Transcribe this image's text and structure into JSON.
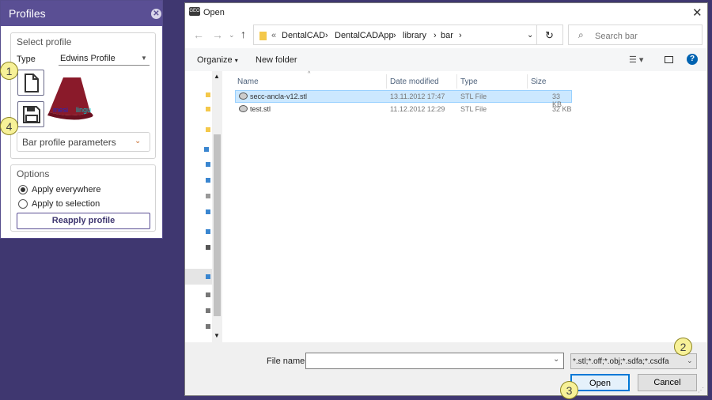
{
  "profiles": {
    "title": "Profiles",
    "select_profile_label": "Select profile",
    "type_label": "Type",
    "type_value": "Edwins Profile",
    "preview_labels": {
      "left": "mesi",
      "right": "lingu"
    },
    "bar_params_label": "Bar profile parameters",
    "options_label": "Options",
    "apply_everywhere": "Apply everywhere",
    "apply_selection": "Apply to selection",
    "reapply_button": "Reapply profile"
  },
  "dialog": {
    "title": "Open",
    "app_icon_text": "GEO",
    "breadcrumb": [
      "«",
      "DentalCAD",
      "DentalCADApp",
      "library",
      "bar"
    ],
    "search_placeholder": "Search bar",
    "organize_label": "Organize",
    "new_folder_label": "New folder",
    "columns": {
      "name": "Name",
      "date": "Date modified",
      "type": "Type",
      "size": "Size"
    },
    "files": [
      {
        "name": "secc-ancla-v12.stl",
        "date": "13.11.2012 17:47",
        "type": "STL File",
        "size": "33 KB",
        "selected": true
      },
      {
        "name": "test.stl",
        "date": "11.12.2012 12:29",
        "type": "STL File",
        "size": "32 KB",
        "selected": false
      }
    ],
    "filename_label": "File name:",
    "filename_value": "",
    "filter_value": "*.stl;*.off;*.obj;*.sdfa;*.csdfa",
    "open_button": "Open",
    "cancel_button": "Cancel"
  },
  "annotations": [
    "1",
    "2",
    "3",
    "4"
  ],
  "colors": {
    "panel_header": "#5a4f94",
    "background": "#3f3770",
    "selection": "#cce8ff",
    "badge": "#f7f198"
  }
}
